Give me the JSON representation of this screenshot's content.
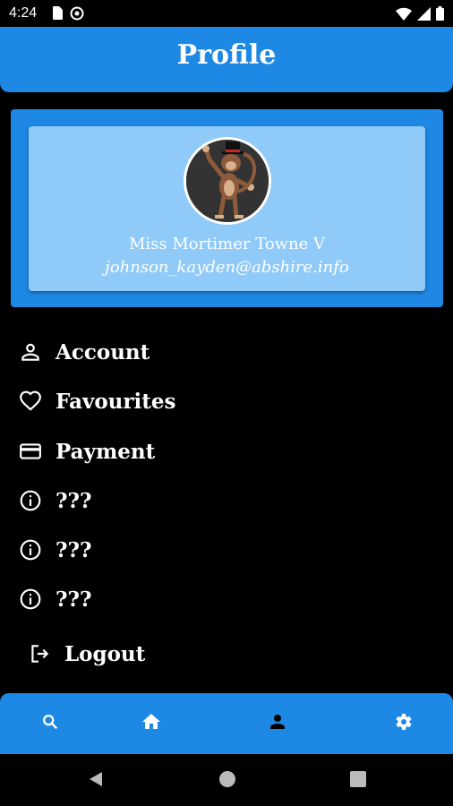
{
  "status_bar": {
    "time": "4:24",
    "left_icons": [
      "sim-card-icon",
      "do-not-disturb-icon"
    ],
    "right_icons": [
      "wifi-icon",
      "signal-icon",
      "battery-icon"
    ]
  },
  "header": {
    "title": "Profile"
  },
  "profile": {
    "name": "Miss Mortimer Towne V",
    "email": "johnson_kayden@abshire.info",
    "avatar_icon": "monkey-avatar"
  },
  "menu": {
    "items": [
      {
        "label": "Account",
        "icon": "person-icon"
      },
      {
        "label": "Favourites",
        "icon": "heart-icon"
      },
      {
        "label": "Payment",
        "icon": "credit-card-icon"
      },
      {
        "label": "???",
        "icon": "info-icon"
      },
      {
        "label": "???",
        "icon": "info-icon"
      },
      {
        "label": "???",
        "icon": "info-icon"
      },
      {
        "label": "Logout",
        "icon": "logout-icon"
      }
    ]
  },
  "bottom_nav": {
    "items": [
      "search-icon",
      "home-icon",
      "person-icon",
      "settings-icon"
    ],
    "selected": "person-icon"
  },
  "system_nav": [
    "back-icon",
    "home-circle-icon",
    "recents-icon"
  ],
  "colors": {
    "primary": "#1e88e5",
    "card": "#90caf9",
    "background": "#000000",
    "text": "#ffffff"
  }
}
